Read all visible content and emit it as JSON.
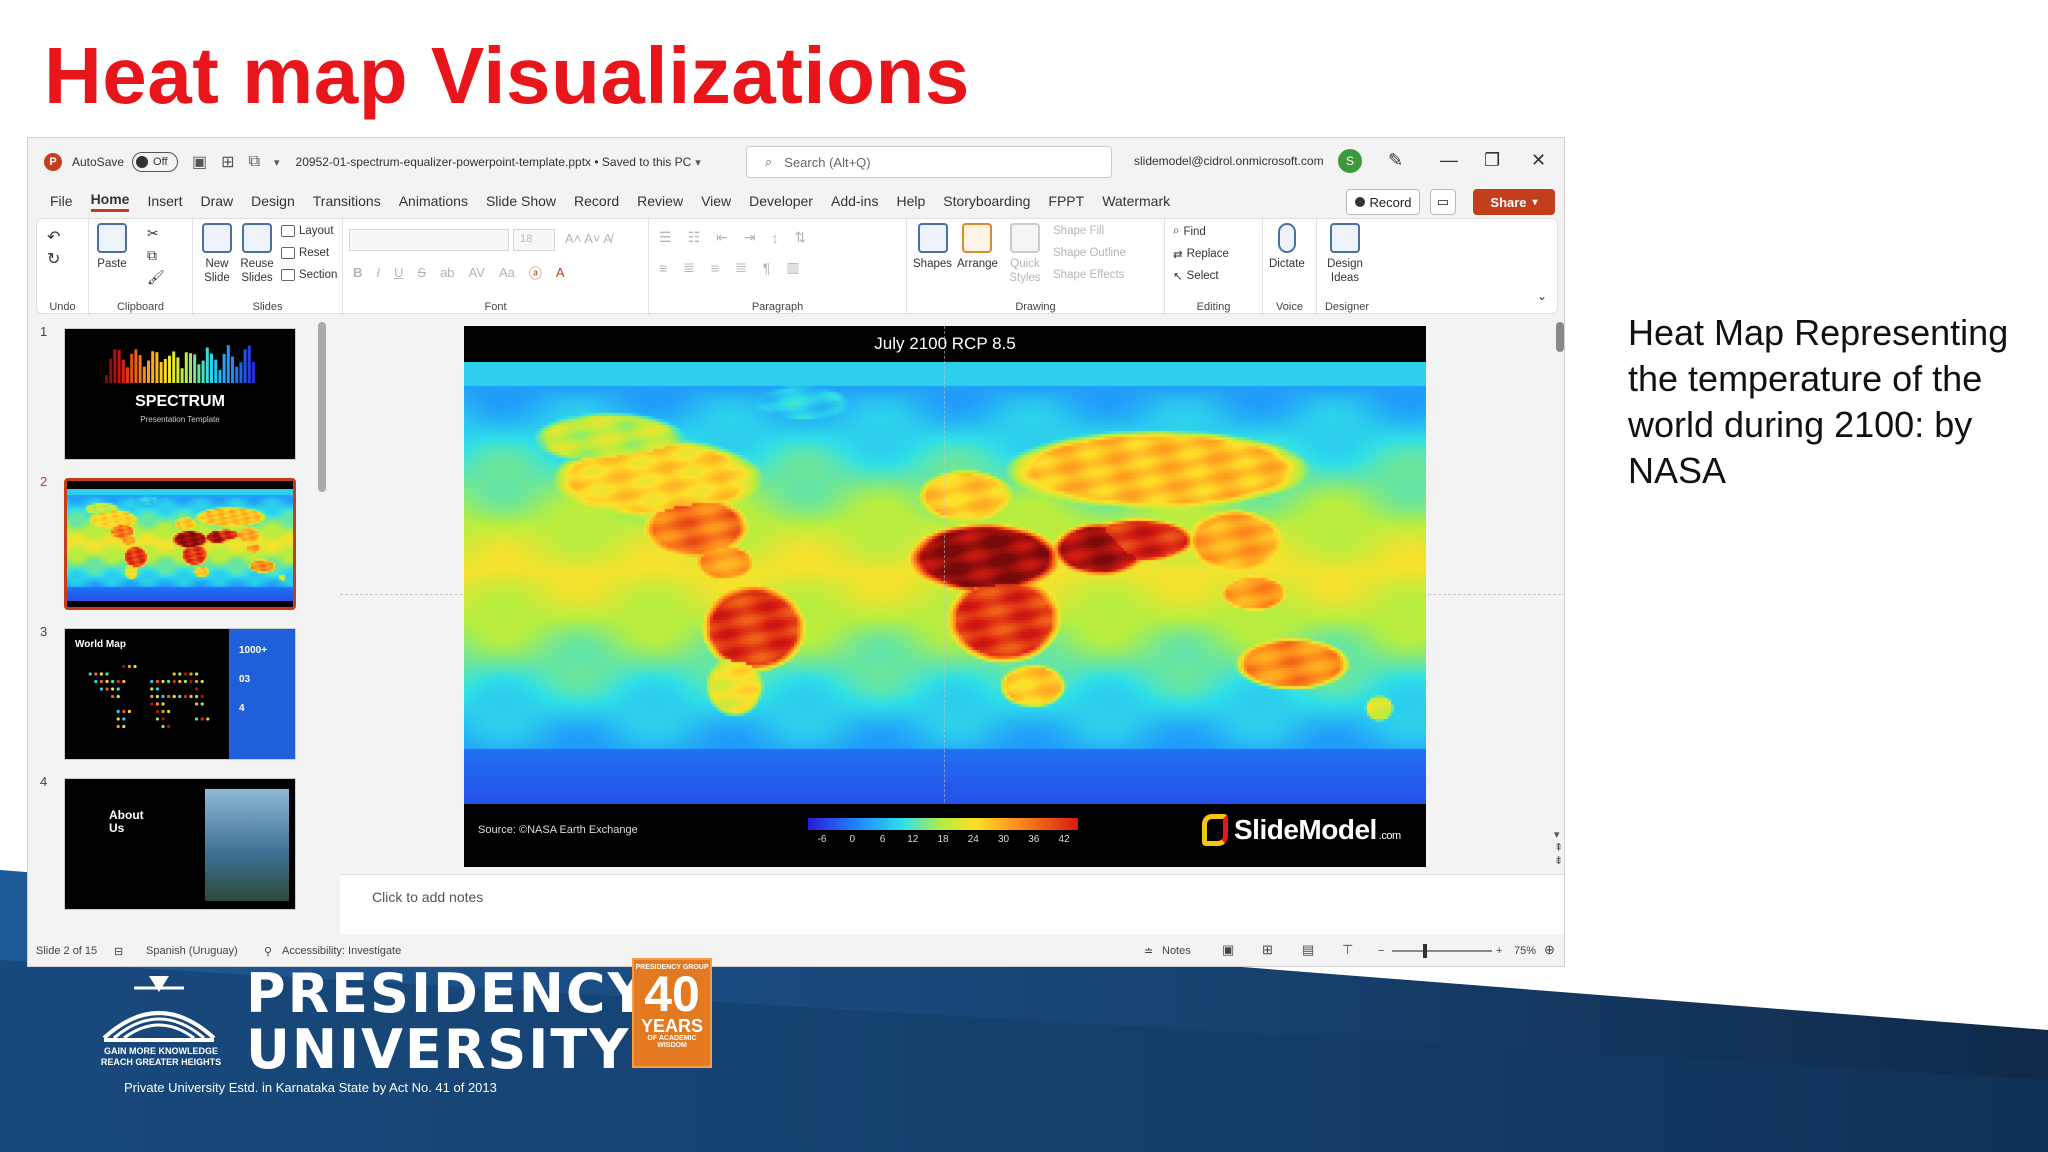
{
  "slide_title": "Heat map Visualizations",
  "caption": "Heat Map Representing the temperature of the world during 2100: by NASA",
  "ppt": {
    "titlebar": {
      "autosave_label": "AutoSave",
      "autosave_state": "Off",
      "filename": "20952-01-spectrum-equalizer-powerpoint-template.pptx • Saved to this PC",
      "search_placeholder": "Search (Alt+Q)",
      "account": "slidemodel@cidrol.onmicrosoft.com",
      "avatar_initial": "S"
    },
    "tabs": [
      "File",
      "Home",
      "Insert",
      "Draw",
      "Design",
      "Transitions",
      "Animations",
      "Slide Show",
      "Record",
      "Review",
      "View",
      "Developer",
      "Add-ins",
      "Help",
      "Storyboarding",
      "FPPT",
      "Watermark"
    ],
    "active_tab": "Home",
    "record_label": "Record",
    "share_label": "Share",
    "ribbon": {
      "undo_label": "Undo",
      "clipboard": {
        "paste": "Paste",
        "label": "Clipboard"
      },
      "slides": {
        "new_slide": "New Slide",
        "reuse_slides": "Reuse Slides",
        "layout": "Layout",
        "reset": "Reset",
        "section": "Section",
        "label": "Slides"
      },
      "font": {
        "label": "Font",
        "size": "18"
      },
      "paragraph": {
        "label": "Paragraph"
      },
      "drawing": {
        "shapes": "Shapes",
        "arrange": "Arrange",
        "quick_styles": "Quick Styles",
        "shape_fill": "Shape Fill",
        "shape_outline": "Shape Outline",
        "shape_effects": "Shape Effects",
        "label": "Drawing"
      },
      "editing": {
        "find": "Find",
        "replace": "Replace",
        "select": "Select",
        "label": "Editing"
      },
      "voice": {
        "dictate": "Dictate",
        "label": "Voice"
      },
      "designer": {
        "design_ideas": "Design Ideas",
        "label": "Designer"
      }
    },
    "thumbnails": [
      {
        "num": "1",
        "title": "SPECTRUM",
        "subtitle": "Presentation Template"
      },
      {
        "num": "2",
        "title": ""
      },
      {
        "num": "3",
        "title": "World Map",
        "stats": [
          "1000+",
          "03",
          "4"
        ]
      },
      {
        "num": "4",
        "title": "About Us"
      }
    ],
    "slide": {
      "header": "July 2100 RCP 8.5",
      "source": "Source: ©NASA Earth Exchange",
      "colorbar_ticks": [
        "-6",
        "0",
        "6",
        "12",
        "18",
        "24",
        "30",
        "36",
        "42"
      ],
      "brand": "SlideModel",
      "brand_suffix": ".com"
    },
    "notes_placeholder": "Click to add notes",
    "status": {
      "slide_count": "Slide 2 of 15",
      "language": "Spanish (Uruguay)",
      "accessibility": "Accessibility: Investigate",
      "notes": "Notes",
      "zoom": "75%"
    }
  },
  "footer": {
    "university_line1": "PRESIDENCY",
    "university_line2": "UNIVERSITY",
    "tagline": "GAIN MORE KNOWLEDGE REACH GREATER HEIGHTS",
    "estd": "Private University Estd. in Karnataka State by Act No. 41 of 2013",
    "badge_group": "PRESIDENCY GROUP",
    "badge_number": "40",
    "badge_years": "YEARS",
    "badge_sub": "OF ACADEMIC WISDOM"
  },
  "colors": {
    "title_red": "#e8161b",
    "accent_orange": "#c43e1c",
    "banner_blue": "#1d4f86"
  }
}
